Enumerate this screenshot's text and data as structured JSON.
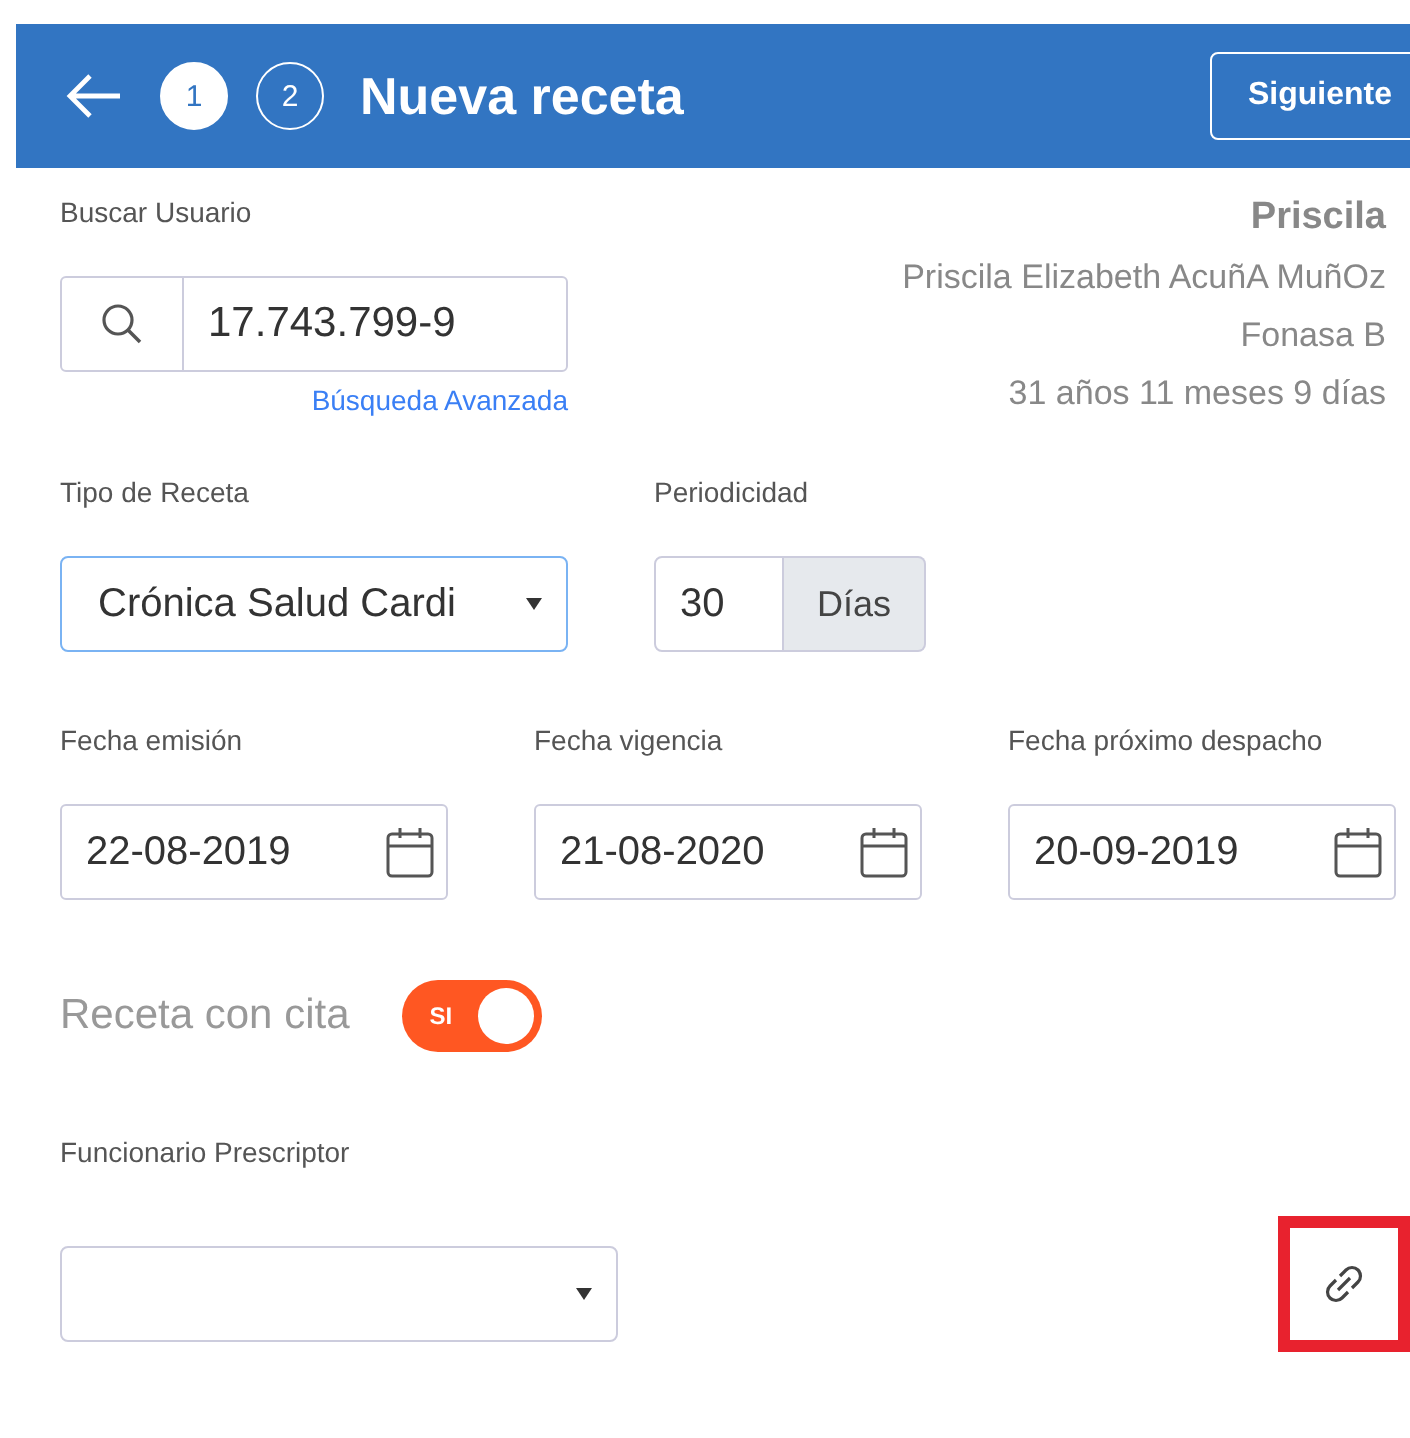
{
  "header": {
    "steps": [
      {
        "label": "1",
        "selected": true
      },
      {
        "label": "2",
        "selected": false
      }
    ],
    "title": "Nueva receta",
    "next_button": "Siguiente"
  },
  "patient_search": {
    "label": "Buscar Usuario",
    "value": "17.743.799-9",
    "advanced_link": "Búsqueda Avanzada"
  },
  "patient": {
    "name": "Priscila",
    "full_name": "Priscila Elizabeth AcuñA MuñOz",
    "insurance": "Fonasa B",
    "age": "31 años 11 meses 9 días"
  },
  "recipe_type": {
    "label": "Tipo de Receta",
    "value": "Crónica Salud Cardi"
  },
  "periodicity": {
    "label": "Periodicidad",
    "value": "30",
    "unit": "Días"
  },
  "dates": [
    {
      "label": "Fecha emisión",
      "value": "22-08-2019"
    },
    {
      "label": "Fecha vigencia",
      "value": "21-08-2020"
    },
    {
      "label": "Fecha próximo despacho",
      "value": "20-09-2019"
    }
  ],
  "appointment": {
    "label": "Receta con cita",
    "on": true,
    "toggle_label": "SI"
  },
  "prescriber": {
    "label": "Funcionario Prescriptor",
    "link_highlighted": true
  }
}
